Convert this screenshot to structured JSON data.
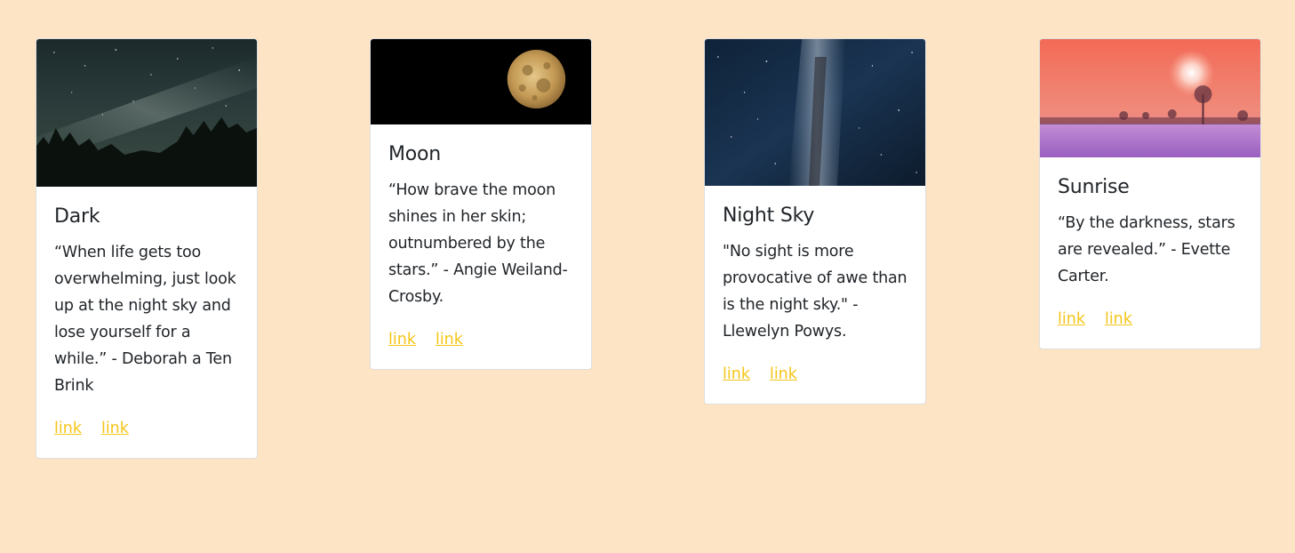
{
  "cards": [
    {
      "title": "Dark",
      "text": "“When life gets too overwhelming, just look up at the night sky and lose yourself for a while.” - Deborah a Ten Brink",
      "links": [
        "link",
        "link"
      ]
    },
    {
      "title": "Moon",
      "text": "“How brave the moon shines in her skin; outnumbered by the stars.” - Angie Weiland-Crosby.",
      "links": [
        "link",
        "link"
      ]
    },
    {
      "title": "Night Sky",
      "text": "\"No sight is more provocative of awe than is the night sky.\" - Llewelyn Powys.",
      "links": [
        "link",
        "link"
      ]
    },
    {
      "title": "Sunrise",
      "text": "“By the darkness, stars are revealed.” - Evette Carter.",
      "links": [
        "link",
        "link"
      ]
    }
  ],
  "colors": {
    "page_background": "#fde4c4",
    "link": "#f5c518",
    "card_background": "#ffffff"
  }
}
